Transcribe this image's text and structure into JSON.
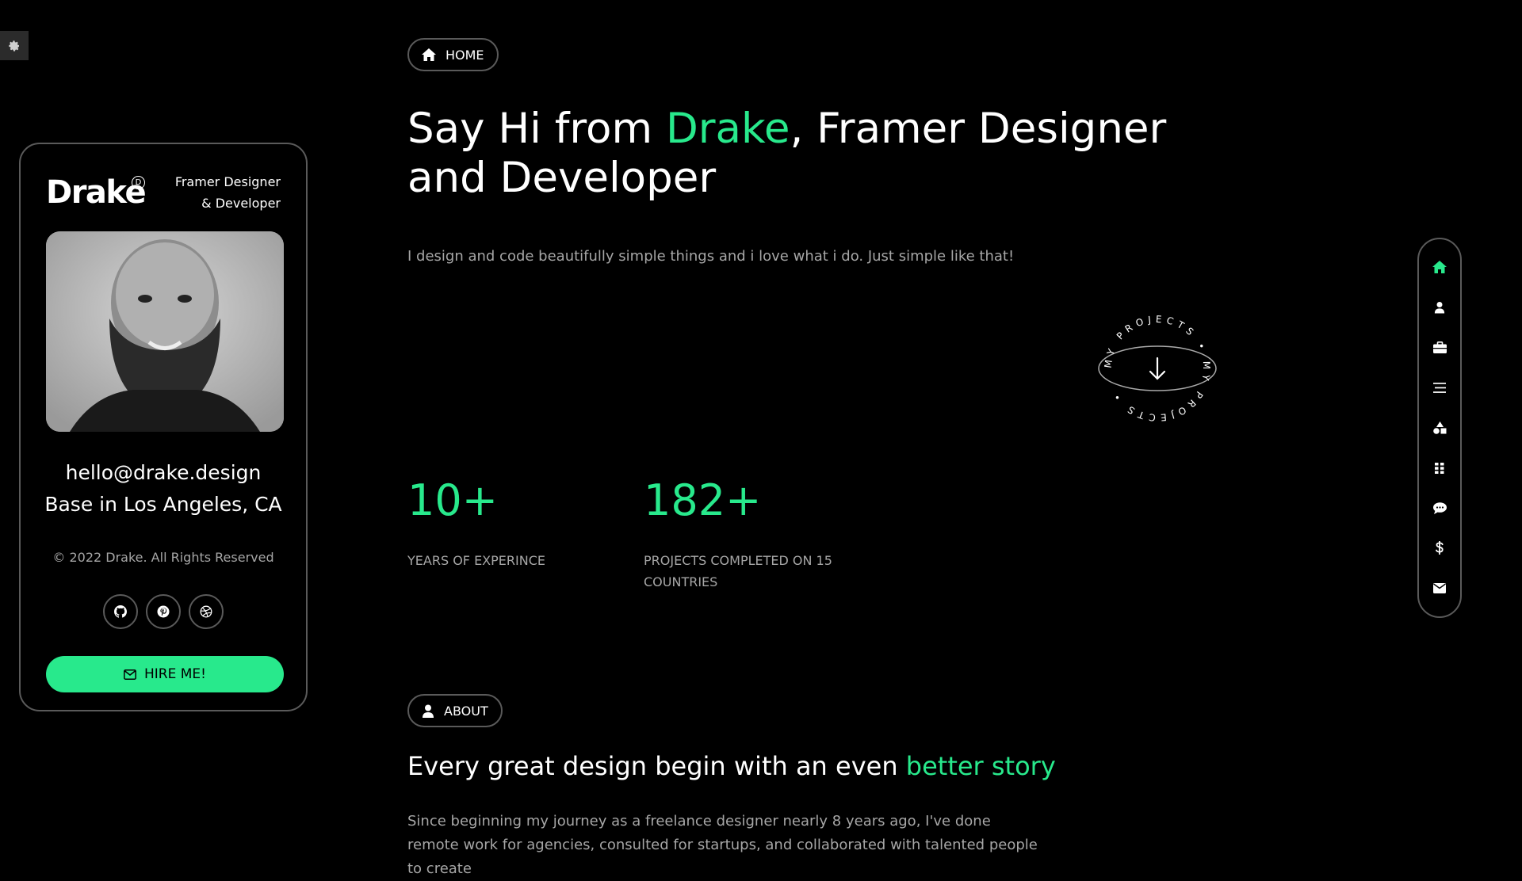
{
  "colors": {
    "accent": "#28e98c",
    "background": "#000000",
    "muted": "#a6a6a6",
    "border": "#5a5a5a"
  },
  "settings": {
    "icon": "gear-icon"
  },
  "profile": {
    "name": "Drake",
    "mark": "D",
    "role_line1": "Framer Designer",
    "role_line2": "& Developer",
    "email": "hello@drake.design",
    "location": "Base in Los Angeles, CA",
    "copyright": "© 2022 Drake. All Rights Reserved",
    "socials": [
      {
        "icon": "github-icon"
      },
      {
        "icon": "pinterest-icon"
      },
      {
        "icon": "dribbble-icon"
      }
    ],
    "hire_label": "HIRE ME!"
  },
  "home_pill": {
    "label": "HOME",
    "icon": "home-icon"
  },
  "hero": {
    "title_before": "Say Hi from ",
    "title_accent": "Drake",
    "title_after": ", Framer Designer and Developer",
    "subtitle": "I design and code beautifully simple things and i love what i do. Just simple like that!"
  },
  "projects_badge": {
    "text": "MY PROJECTS • MY PROJECTS •",
    "icon": "arrow-down-icon"
  },
  "stats": [
    {
      "value": "10+",
      "label_line1": "YEARS OF EXPERINCE",
      "label_line2": ""
    },
    {
      "value": "182+",
      "label_line1": "PROJECTS COMPLETED ON 15",
      "label_line2": "COUNTRIES"
    }
  ],
  "about_pill": {
    "label": "ABOUT",
    "icon": "user-icon"
  },
  "about": {
    "title_before": "Every great design begin with an even ",
    "title_accent": "better story",
    "text": "Since beginning my journey as a freelance designer nearly 8 years ago, I've done remote work for agencies, consulted for startups, and collaborated with talented people to create"
  },
  "sidenav": [
    {
      "icon": "home-icon",
      "active": true
    },
    {
      "icon": "user-icon",
      "active": false
    },
    {
      "icon": "briefcase-icon",
      "active": false
    },
    {
      "icon": "list-icon",
      "active": false
    },
    {
      "icon": "shapes-icon",
      "active": false
    },
    {
      "icon": "grid-icon",
      "active": false
    },
    {
      "icon": "comment-icon",
      "active": false
    },
    {
      "icon": "dollar-icon",
      "active": false
    },
    {
      "icon": "envelope-icon",
      "active": false
    }
  ]
}
